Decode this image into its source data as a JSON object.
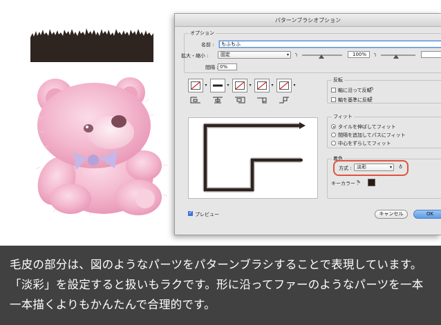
{
  "dialog": {
    "title": "パターンブラシオプション",
    "options_legend": "オプション",
    "name_label": "名前 :",
    "name_value": "もふもふ",
    "scale_label": "拡大・縮小 :",
    "scale_mode": "固定",
    "scale_percent": "100%",
    "spacing_label": "間隔 :",
    "spacing_value": "0%",
    "flip_legend": "反転",
    "flip_along": "軸に沿って反転",
    "flip_across": "軸を基準に反転",
    "fit_legend": "フィット",
    "fit_options": [
      "タイルを伸ばしてフィット",
      "間隔を追加してパスにフィット",
      "中心をずらしてフィット"
    ],
    "fit_selected_index": 0,
    "colorize_legend": "着色",
    "method_label": "方式 :",
    "method_value": "淡彩",
    "key_color_label": "キーカラー :",
    "key_color": "#2a1a14",
    "preview_label": "プレビュー",
    "preview_checked": true,
    "cancel_label": "キャンセル",
    "ok_label": "OK"
  },
  "caption": {
    "text": "毛皮の部分は、図のようなパーツをパターンブラシすることで表現しています。「淡彩」を設定すると扱いもラクです。形に沿ってファーのようなパーツを一本一本描くよりもかんたんで合理的です。"
  },
  "colors": {
    "highlight": "#e0523b",
    "caption_bg": "#414141",
    "bear_pink": "#f2b6cc",
    "fur_dark": "#2e2420"
  }
}
